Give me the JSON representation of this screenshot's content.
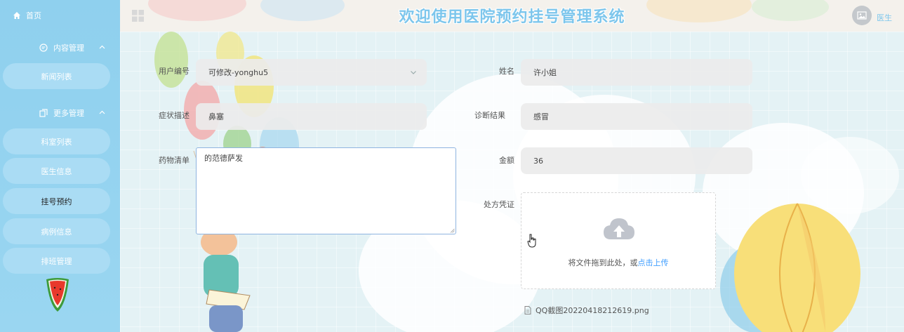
{
  "sidebar": {
    "home": "首页",
    "groups": [
      {
        "title": "内容管理",
        "items": [
          "新闻列表"
        ]
      },
      {
        "title": "更多管理",
        "items": [
          "科室列表",
          "医生信息",
          "挂号预约",
          "病例信息",
          "排班管理"
        ]
      }
    ],
    "active_item": "挂号预约"
  },
  "header": {
    "title": "欢迎使用医院预约挂号管理系统",
    "user": "医生"
  },
  "form": {
    "user_id_label": "用户编号",
    "user_id_value": "可修改-yonghu5",
    "name_label": "姓名",
    "name_value": "许小姐",
    "symptom_label": "症状描述",
    "symptom_value": "鼻塞",
    "diagnosis_label": "诊断结果",
    "diagnosis_value": "感冒",
    "medicine_label": "药物清单",
    "medicine_value": "的范德萨发",
    "amount_label": "金额",
    "amount_value": "36",
    "prescription_label": "处方凭证",
    "upload_hint": "将文件拖到此处，或",
    "upload_link": "点击上传",
    "file_name": "QQ截图20220418212619.png"
  },
  "colors": {
    "sidebar_bg": "#8fd0ee",
    "title_color": "#7dc6ec",
    "link_color": "#409eff"
  }
}
